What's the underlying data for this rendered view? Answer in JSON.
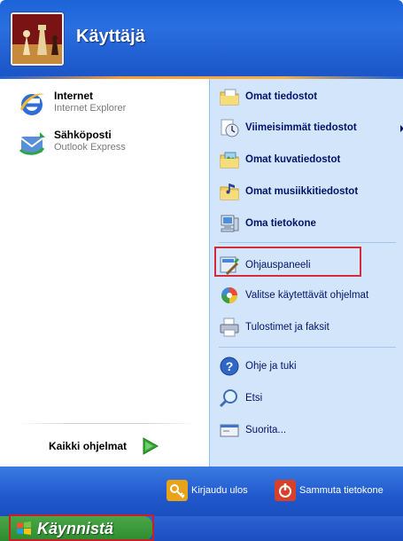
{
  "header": {
    "user_name": "Käyttäjä"
  },
  "left": {
    "pinned": [
      {
        "title": "Internet",
        "subtitle": "Internet Explorer",
        "icon": "ie-icon"
      },
      {
        "title": "Sähköposti",
        "subtitle": "Outlook Express",
        "icon": "outlook-express-icon"
      }
    ],
    "all_programs_label": "Kaikki ohjelmat"
  },
  "right": {
    "items": [
      {
        "label": "Omat tiedostot",
        "bold": true,
        "icon": "my-documents-icon"
      },
      {
        "label": "Viimeisimmät tiedostot",
        "bold": true,
        "icon": "recent-documents-icon",
        "submenu": true
      },
      {
        "label": "Omat kuvatiedostot",
        "bold": true,
        "icon": "my-pictures-icon"
      },
      {
        "label": "Omat musiikkitiedostot",
        "bold": true,
        "icon": "my-music-icon"
      },
      {
        "label": "Oma tietokone",
        "bold": true,
        "icon": "my-computer-icon"
      },
      {
        "label": "Ohjauspaneeli",
        "bold": false,
        "icon": "control-panel-icon",
        "highlighted": true
      },
      {
        "label": "Valitse käytettävät ohjelmat",
        "bold": false,
        "icon": "set-program-access-icon"
      },
      {
        "label": "Tulostimet ja faksit",
        "bold": false,
        "icon": "printers-icon"
      },
      {
        "label": "Ohje ja tuki",
        "bold": false,
        "icon": "help-icon"
      },
      {
        "label": "Etsi",
        "bold": false,
        "icon": "search-icon"
      },
      {
        "label": "Suorita...",
        "bold": false,
        "icon": "run-icon"
      }
    ]
  },
  "footer": {
    "logoff_label": "Kirjaudu ulos",
    "shutdown_label": "Sammuta tietokone"
  },
  "taskbar": {
    "start_label": "Käynnistä"
  },
  "colors": {
    "highlight_outline": "#d42a3a",
    "header_blue": "#1d63d9",
    "right_panel": "#d3e5fa",
    "start_green": "#3b9a3b"
  }
}
